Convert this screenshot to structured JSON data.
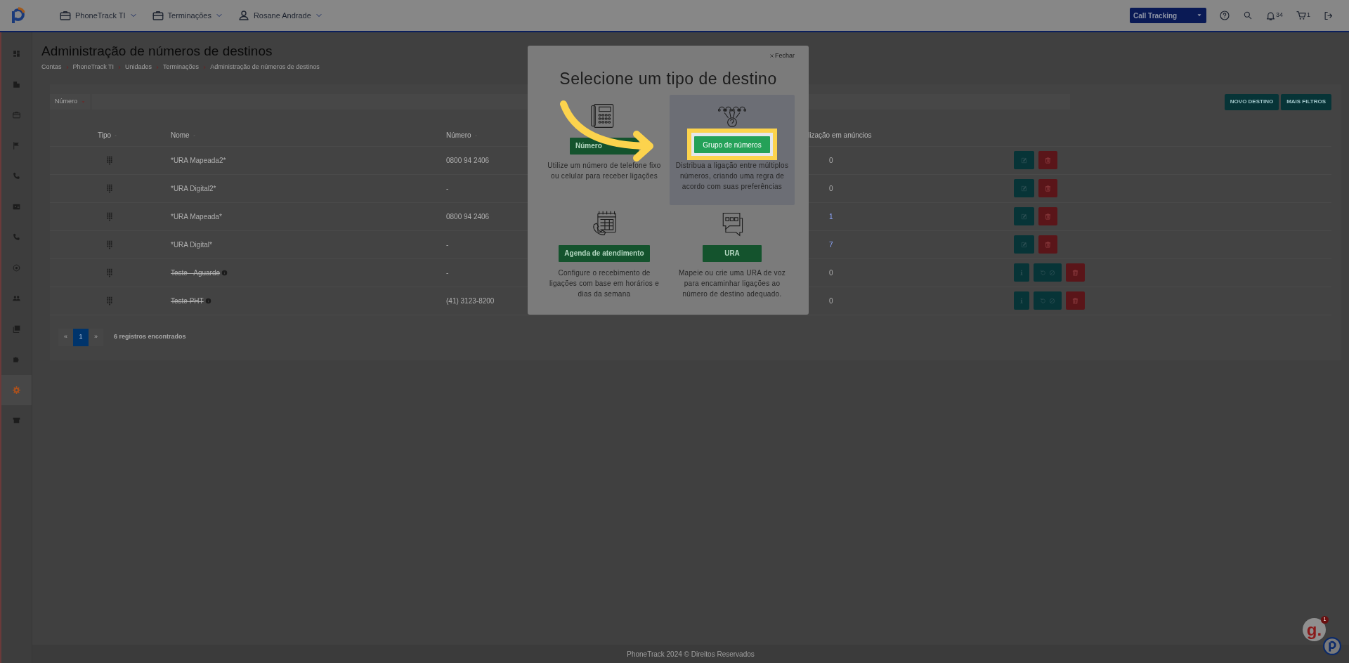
{
  "topbar": {
    "menus": [
      {
        "label": "PhoneTrack TI"
      },
      {
        "label": "Terminações"
      },
      {
        "label": "Rosane Andrade"
      }
    ],
    "product_select": "Call Tracking",
    "notifications": "34",
    "cart": "1"
  },
  "sidebar": {
    "items": [
      {
        "selected": false
      },
      {
        "selected": false
      },
      {
        "selected": false
      },
      {
        "selected": false
      },
      {
        "selected": false
      },
      {
        "selected": false
      },
      {
        "selected": false
      },
      {
        "selected": false
      },
      {
        "selected": false
      },
      {
        "selected": false
      },
      {
        "selected": false
      },
      {
        "selected": true
      },
      {
        "selected": false
      }
    ]
  },
  "page": {
    "title": "Administração de números de destinos",
    "breadcrumb": [
      "Contas",
      "PhoneTrack TI",
      "Unidades",
      "Terminações",
      "Administração de números de destinos"
    ]
  },
  "filter": {
    "field": "Número",
    "buttons": [
      "NOVO DESTINO",
      "MAIS FILTROS"
    ]
  },
  "table": {
    "columns": [
      {
        "label": "Tipo",
        "sortable": true
      },
      {
        "label": "Nome",
        "sortable": true
      },
      {
        "label": "Número",
        "sortable": true
      },
      {
        "label": "lização em anúncios",
        "sortable": false
      }
    ],
    "rows": [
      {
        "name": "*URA Mapeada2*",
        "number": "0800 94 2406",
        "usage": "0",
        "usage_link": false,
        "disabled": false
      },
      {
        "name": "*URA Digital2*",
        "number": "-",
        "usage": "0",
        "usage_link": false,
        "disabled": false
      },
      {
        "name": "*URA Mapeada*",
        "number": "0800 94 2406",
        "usage": "1",
        "usage_link": true,
        "disabled": false
      },
      {
        "name": "*URA Digital*",
        "number": "-",
        "usage": "7",
        "usage_link": true,
        "disabled": false
      },
      {
        "name": "Teste - Aguarde",
        "number": "-",
        "usage": "0",
        "usage_link": false,
        "disabled": true
      },
      {
        "name": "Teste PHT",
        "number": "(41) 3123-8200",
        "usage": "0",
        "usage_link": false,
        "disabled": true
      }
    ]
  },
  "pagination": {
    "prev": "«",
    "pages": [
      {
        "label": "1",
        "selected": true
      }
    ],
    "next": "»",
    "summary": "6 registros encontrados"
  },
  "modal": {
    "close": "Fechar",
    "title": "Selecione um tipo de destino",
    "options": [
      {
        "button": "Número",
        "description": "Utilize um número de telefone fixo ou celular para receber ligações",
        "selected": false
      },
      {
        "button": "Grupo de números",
        "description": "Distribua a ligação entre múltiplos números, criando uma regra de acordo com suas preferências",
        "selected": true
      },
      {
        "button": "Agenda de atendimento",
        "description": "Configure o recebimento de ligações com base em horários e dias da semana",
        "selected": false
      },
      {
        "button": "URA",
        "description": "Mapeie ou crie uma URA de voz para encaminhar ligações ao número de destino adequado.",
        "selected": false
      }
    ]
  },
  "footer": "PhoneTrack 2024 © Direitos Reservados",
  "chat_widget": {
    "label": "g.",
    "badge": "1"
  }
}
